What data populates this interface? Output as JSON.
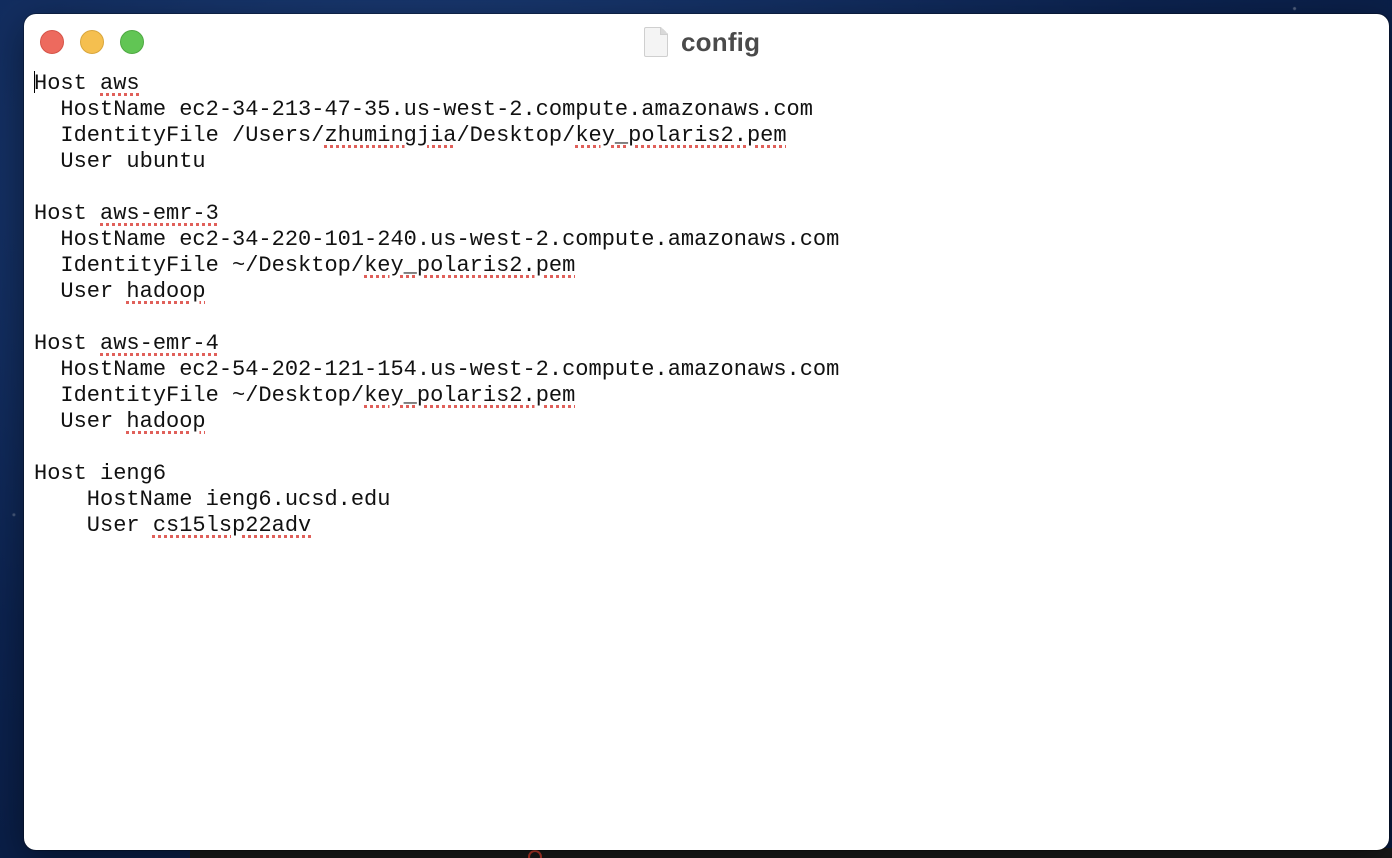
{
  "window": {
    "title": "config",
    "title_icon": "document-icon"
  },
  "editor": {
    "lines": [
      [
        {
          "t": "Host "
        },
        {
          "t": "aws",
          "s": true
        }
      ],
      [
        {
          "t": "  HostName ec2-34-213-47-35.us-west-2.compute.amazonaws.com"
        }
      ],
      [
        {
          "t": "  IdentityFile /Users/"
        },
        {
          "t": "zhumingjia",
          "s": true
        },
        {
          "t": "/Desktop/"
        },
        {
          "t": "key_polaris2.pem",
          "s": true
        }
      ],
      [
        {
          "t": "  User ubuntu"
        }
      ],
      [],
      [
        {
          "t": "Host "
        },
        {
          "t": "aws-emr-3",
          "s": true
        }
      ],
      [
        {
          "t": "  HostName ec2-34-220-101-240.us-west-2.compute.amazonaws.com"
        }
      ],
      [
        {
          "t": "  IdentityFile ~/Desktop/"
        },
        {
          "t": "key_polaris2.pem",
          "s": true
        }
      ],
      [
        {
          "t": "  User "
        },
        {
          "t": "hadoop",
          "s": true
        }
      ],
      [],
      [
        {
          "t": "Host "
        },
        {
          "t": "aws-emr-4",
          "s": true
        }
      ],
      [
        {
          "t": "  HostName ec2-54-202-121-154.us-west-2.compute.amazonaws.com"
        }
      ],
      [
        {
          "t": "  IdentityFile ~/Desktop/"
        },
        {
          "t": "key_polaris2.pem",
          "s": true
        }
      ],
      [
        {
          "t": "  User "
        },
        {
          "t": "hadoop",
          "s": true
        }
      ],
      [],
      [
        {
          "t": "Host ieng6"
        }
      ],
      [
        {
          "t": "    HostName ieng6.ucsd.edu"
        }
      ],
      [
        {
          "t": "    User "
        },
        {
          "t": "cs15lsp22adv",
          "s": true
        }
      ]
    ]
  },
  "colors": {
    "spellcheck_underline": "#e0605a",
    "close": "#ed6a5e",
    "minimize": "#f5bf4f",
    "zoom": "#61c554"
  }
}
